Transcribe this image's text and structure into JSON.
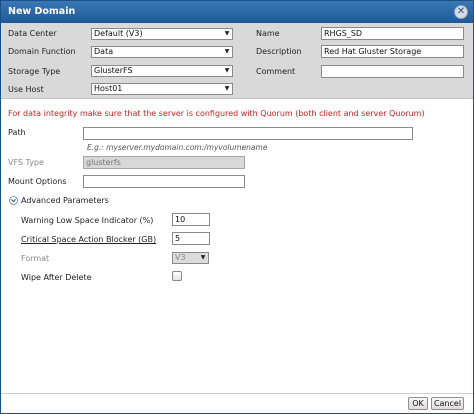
{
  "dialog": {
    "title": "New Domain"
  },
  "top": {
    "data_center": {
      "label": "Data Center",
      "value": "Default (V3)"
    },
    "domain_function": {
      "label": "Domain Function",
      "value": "Data"
    },
    "storage_type": {
      "label": "Storage Type",
      "value": "GlusterFS"
    },
    "use_host": {
      "label": "Use Host",
      "value": "Host01"
    },
    "name": {
      "label": "Name",
      "value": "RHGS_SD"
    },
    "description": {
      "label": "Description",
      "value": "Red Hat Gluster Storage"
    },
    "comment": {
      "label": "Comment",
      "value": ""
    }
  },
  "warning": "For data integrity make sure that the server is configured with Quorum (both client and server Quorum)",
  "path": {
    "label": "Path",
    "value": "",
    "hint": "E.g.: myserver.mydomain.com:/myvolumename"
  },
  "vfs_type": {
    "label": "VFS Type",
    "value": "glusterfs"
  },
  "mount_options": {
    "label": "Mount Options",
    "value": ""
  },
  "advanced": {
    "label": "Advanced Parameters",
    "warning_low_space": {
      "label": "Warning Low Space Indicator (%)",
      "value": "10"
    },
    "critical_space": {
      "label": "Critical Space Action Blocker (GB)",
      "value": "5"
    },
    "format": {
      "label": "Format",
      "value": "V3"
    },
    "wipe_after_delete": {
      "label": "Wipe After Delete",
      "checked": false
    }
  },
  "footer": {
    "ok_label": "OK",
    "cancel_label": "Cancel"
  },
  "colors": {
    "titlebar": "#1f5a98",
    "panel": "#d9d9d9",
    "warning": "#cc2222"
  }
}
